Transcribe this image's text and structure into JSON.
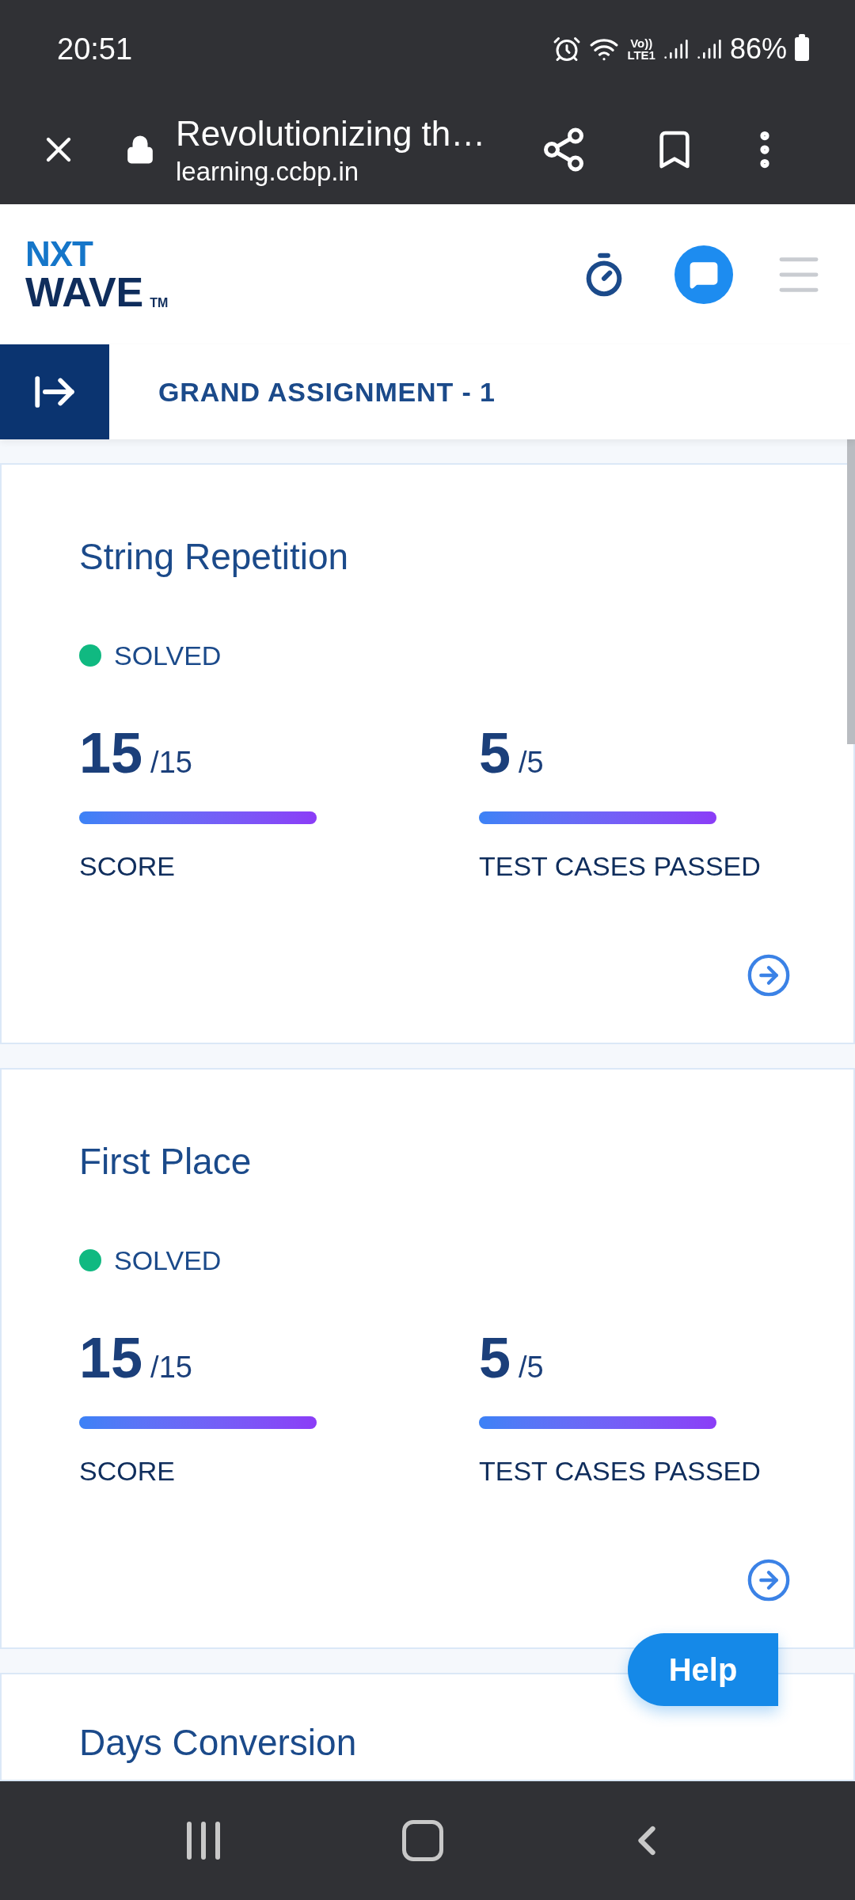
{
  "status_bar": {
    "time": "20:51",
    "network_top": "Vo))",
    "network_bottom": "LTE1",
    "battery": "86%"
  },
  "browser": {
    "title": "Revolutionizing th…",
    "url": "learning.ccbp.in"
  },
  "logo": {
    "line1": "NXT",
    "line2": "WAVE",
    "mark": "TM"
  },
  "assignment": {
    "title": "GRAND ASSIGNMENT - 1"
  },
  "problems": [
    {
      "kind": "full",
      "title": "String Repetition",
      "status": "SOLVED",
      "color": "#10b981",
      "metrics": [
        {
          "value": "15",
          "total": "/15",
          "level": 1,
          "label": "SCORE"
        },
        {
          "value": "5",
          "total": "/5",
          "level": 1,
          "label": "TEST CASES PASSED"
        }
      ]
    },
    {
      "kind": "full",
      "title": "First Place",
      "status": "SOLVED",
      "color": "#10b981",
      "metrics": [
        {
          "value": "15",
          "total": "/15",
          "level": 1,
          "label": "SCORE"
        },
        {
          "value": "5",
          "total": "/5",
          "level": 1,
          "label": "TEST CASES PASSED"
        }
      ]
    },
    {
      "kind": "partial",
      "title": "Days Conversion"
    }
  ],
  "help_button": "Help"
}
